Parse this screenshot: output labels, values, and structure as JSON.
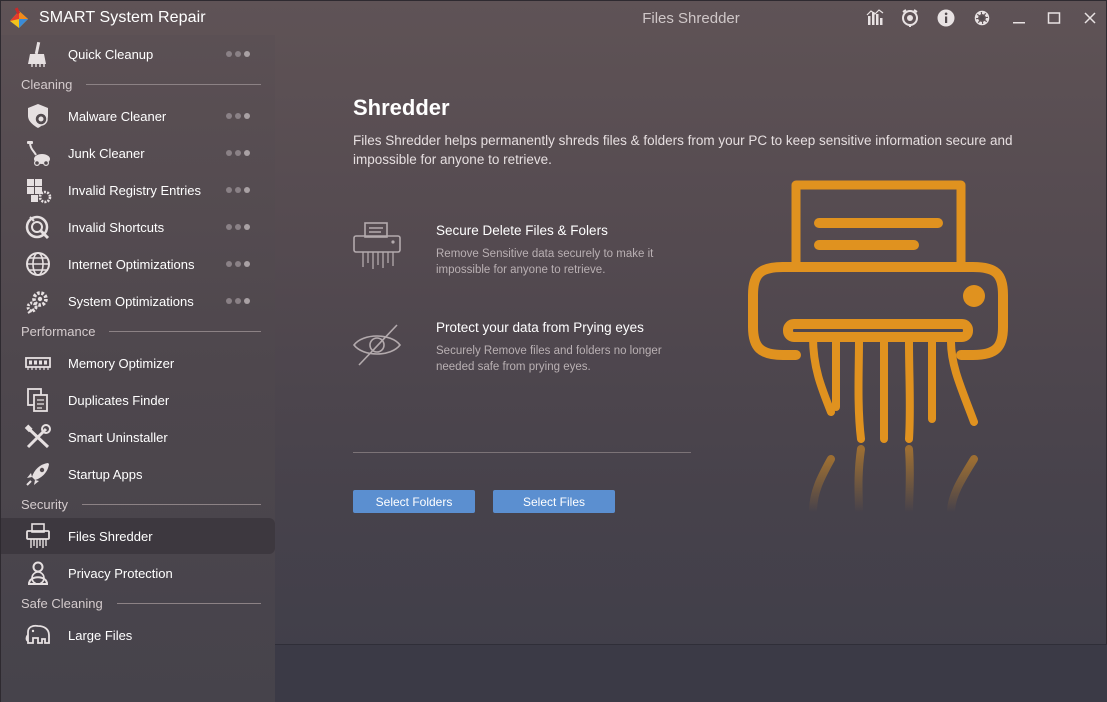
{
  "app": {
    "title": "SMART System Repair",
    "window_title": "Files Shredder"
  },
  "titlebar_icons": [
    "stats-icon",
    "scan-icon",
    "info-icon",
    "settings-icon",
    "minimize-icon",
    "maximize-icon",
    "close-icon"
  ],
  "sidebar": {
    "quick": {
      "label": "Quick Cleanup",
      "icon": "broom-icon"
    },
    "sections": {
      "cleaning": "Cleaning",
      "performance": "Performance",
      "security": "Security",
      "safe_cleaning": "Safe Cleaning"
    },
    "cleaning_items": [
      {
        "label": "Malware Cleaner",
        "icon": "malware-icon"
      },
      {
        "label": "Junk Cleaner",
        "icon": "vacuum-icon"
      },
      {
        "label": "Invalid Registry Entries",
        "icon": "registry-icon"
      },
      {
        "label": "Invalid Shortcuts",
        "icon": "shortcut-icon"
      },
      {
        "label": "Internet Optimizations",
        "icon": "globe-icon"
      },
      {
        "label": "System Optimizations",
        "icon": "gears-icon"
      }
    ],
    "performance_items": [
      {
        "label": "Memory Optimizer",
        "icon": "memory-icon"
      },
      {
        "label": "Duplicates Finder",
        "icon": "duplicate-icon"
      },
      {
        "label": "Smart Uninstaller",
        "icon": "tools-icon"
      },
      {
        "label": "Startup Apps",
        "icon": "rocket-icon"
      }
    ],
    "security_items": [
      {
        "label": "Files Shredder",
        "icon": "shredder-icon",
        "active": true
      },
      {
        "label": "Privacy Protection",
        "icon": "privacy-icon"
      }
    ],
    "safe_items": [
      {
        "label": "Large Files",
        "icon": "elephant-icon"
      }
    ]
  },
  "main": {
    "title": "Shredder",
    "description": "Files Shredder helps permanently shreds files & folders from your PC to keep sensitive information secure and impossible for anyone to retrieve.",
    "features": [
      {
        "title": "Secure Delete Files & Folers",
        "description": "Remove Sensitive data securely to make it impossible for anyone to retrieve.",
        "icon": "shredder-outline-icon"
      },
      {
        "title": "Protect your data from Prying eyes",
        "description": "Securely Remove files and folders no longer needed safe from prying eyes.",
        "icon": "eye-slash-icon"
      }
    ],
    "buttons": {
      "select_folders": "Select Folders",
      "select_files": "Select Files"
    }
  },
  "colors": {
    "accent_orange": "#e0921f",
    "button_blue": "#5b8fd0",
    "active_item_bg": "#3d383f"
  }
}
